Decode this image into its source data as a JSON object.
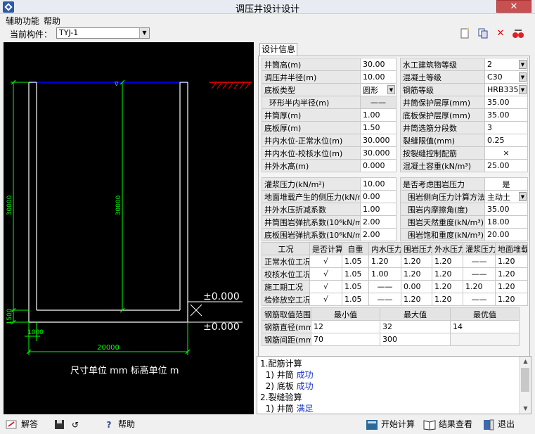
{
  "window": {
    "title": "调压井设计设计",
    "close": "✕"
  },
  "menu": {
    "items": [
      "辅助功能",
      "帮助"
    ]
  },
  "toolbar": {
    "component_label": "当前构件：",
    "component_value": "TYJ-1"
  },
  "tab": {
    "label": "设计信息"
  },
  "params_left": [
    {
      "label": "井筒高(m)",
      "value": "30.00"
    },
    {
      "label": "调压井半径(m)",
      "value": "10.00"
    },
    {
      "label": "底板类型",
      "value": "圆形"
    },
    {
      "label": "环形半内半径(m)",
      "value": "——"
    },
    {
      "label": "井筒厚(m)",
      "value": "1.00"
    },
    {
      "label": "底板厚(m)",
      "value": "1.50"
    },
    {
      "label": "井内水位-正常水位(m)",
      "value": "30.000"
    },
    {
      "label": "井内水位-校核水位(m)",
      "value": "30.000"
    },
    {
      "label": "井外水高(m)",
      "value": "0.000"
    }
  ],
  "params_right": [
    {
      "label": "水工建筑物等级",
      "value": "2"
    },
    {
      "label": "混凝土等级",
      "value": "C30"
    },
    {
      "label": "钢筋等级",
      "value": "HRB335"
    },
    {
      "label": "井筒保护层厚(mm)",
      "value": "35.00"
    },
    {
      "label": "底板保护层厚(mm)",
      "value": "35.00"
    },
    {
      "label": "井筒选筋分段数",
      "value": "3"
    },
    {
      "label": "裂缝限值(mm)",
      "value": "0.25"
    },
    {
      "label": "按裂缝控制配筋",
      "value": "×"
    },
    {
      "label": "混凝土容重(kN/m³)",
      "value": "25.00"
    }
  ],
  "params2_left": [
    {
      "label": "灌浆压力(kN/m²)",
      "value": "10.00"
    },
    {
      "label": "地面堆载产生的侧压力(kN/m²)",
      "value": "0.00"
    },
    {
      "label": "井外水压折减系数",
      "value": "1.00"
    },
    {
      "label": "井筒围岩弹抗系数(10⁶kN/m³)",
      "value": "2.00"
    },
    {
      "label": "底板围岩弹抗系数(10⁶kN/m³)",
      "value": "2.00"
    }
  ],
  "params2_right": [
    {
      "label": "是否考虑围岩压力",
      "value": "是"
    },
    {
      "label": "围岩侧向压力计算方法",
      "value": "主动土"
    },
    {
      "label": "围岩内摩擦角(度)",
      "value": "35.00"
    },
    {
      "label": "围岩天然重度(kN/m³)",
      "value": "18.00"
    },
    {
      "label": "围岩饱和重度(kN/m³)",
      "value": "20.00"
    }
  ],
  "cases": {
    "headers": [
      "工况",
      "是否计算",
      "自重",
      "内水压力",
      "围岩压力",
      "外水压力",
      "灌浆压力",
      "地面堆载"
    ],
    "rows": [
      [
        "正常水位工况",
        "√",
        "1.05",
        "1.20",
        "1.20",
        "1.20",
        "——",
        "1.20"
      ],
      [
        "校核水位工况",
        "√",
        "1.05",
        "1.00",
        "1.20",
        "1.20",
        "——",
        "1.20"
      ],
      [
        "施工期工况",
        "√",
        "1.05",
        "——",
        "0.00",
        "1.20",
        "1.20",
        "1.20"
      ],
      [
        "检修放空工况",
        "√",
        "1.05",
        "——",
        "1.20",
        "1.20",
        "——",
        "1.20"
      ]
    ]
  },
  "rebar": {
    "headers": [
      "钢筋取值范围",
      "最小值",
      "最大值",
      "最优值"
    ],
    "rows": [
      [
        "钢筋直径(mm)",
        "12",
        "32",
        "14"
      ],
      [
        "钢筋间距(mm)",
        "70",
        "300",
        ""
      ]
    ]
  },
  "log": {
    "lines": [
      {
        "text": "1.配筋计算",
        "status": ""
      },
      {
        "text": "  1) 井筒 ",
        "status": "成功"
      },
      {
        "text": "  2) 底板 ",
        "status": "成功"
      },
      {
        "text": "2.裂缝验算",
        "status": ""
      },
      {
        "text": "  1) 井筒 ",
        "status": "满足"
      }
    ]
  },
  "drawing": {
    "dim_height_left": "30000",
    "dim_height_inner": "30000",
    "dim_bottom": "1500",
    "dim_wall": "1000",
    "dim_width": "20000",
    "level_top": "±0.000",
    "level_bottom": "±0.000",
    "unit_note": "尺寸单位 mm    标高单位 m"
  },
  "bottom": {
    "answer": "解答",
    "help": "帮助",
    "start": "开始计算",
    "result": "结果查看",
    "exit": "退出"
  },
  "colors": {
    "canvas_bg": "#000000",
    "wall": "#ffffff",
    "dim": "#00ff00",
    "water": "#0000ff",
    "ground": "#ff0000",
    "link": "#1a32c8"
  }
}
